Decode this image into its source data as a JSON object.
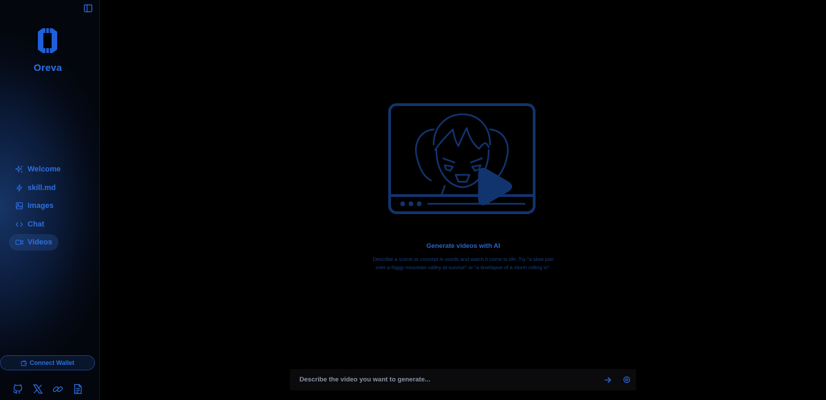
{
  "app": {
    "name": "Oreva"
  },
  "sidebar": {
    "items": [
      {
        "label": "Welcome",
        "icon": "sparkles-icon",
        "active": false
      },
      {
        "label": "skill.md",
        "icon": "lightning-icon",
        "active": false
      },
      {
        "label": "Images",
        "icon": "image-icon",
        "active": false
      },
      {
        "label": "Chat",
        "icon": "code-icon",
        "active": false
      },
      {
        "label": "Videos",
        "icon": "video-icon",
        "active": true
      }
    ],
    "connect_label": "Connect Wallet",
    "social": [
      "github-icon",
      "x-icon",
      "link-icon",
      "document-icon"
    ]
  },
  "main": {
    "title": "Generate videos with AI",
    "description": "Describe a scene or concept in words and watch it come to life. Try \"a slow pan over a foggy mountain valley at sunrise\" or \"a timelapse of a storm rolling in\"."
  },
  "prompt": {
    "placeholder": "Describe the video you want to generate...",
    "value": ""
  },
  "colors": {
    "accent": "#2d6fe0",
    "background": "#000000",
    "sidebar": "#0c1d3d"
  }
}
